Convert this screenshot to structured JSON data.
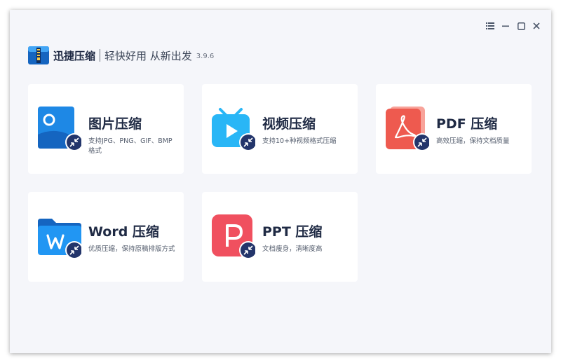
{
  "header": {
    "app_name": "迅捷压缩",
    "slogan": "轻快好用 从新出发",
    "version": "3.9.6"
  },
  "window_controls": {
    "menu_icon": "list-icon",
    "minimize_icon": "minimize-icon",
    "maximize_icon": "maximize-icon",
    "close_icon": "close-icon"
  },
  "cards": [
    {
      "title": "图片压缩",
      "desc": "支持JPG、PNG、GIF、BMP格式",
      "icon": "image-icon",
      "color": "#1e88e5"
    },
    {
      "title": "视频压缩",
      "desc": "支持10+种视频格式压缩",
      "icon": "video-icon",
      "color": "#29b6f6"
    },
    {
      "title": "PDF 压缩",
      "desc": "高效压缩，保持文档质量",
      "icon": "pdf-icon",
      "color": "#ee5a4f"
    },
    {
      "title": "Word 压缩",
      "desc": "优质压缩，保持原稿排版方式",
      "icon": "word-icon",
      "color": "#2196f3"
    },
    {
      "title": "PPT 压缩",
      "desc": "文档瘦身，清晰度高",
      "icon": "ppt-icon",
      "color": "#f0505f"
    }
  ]
}
